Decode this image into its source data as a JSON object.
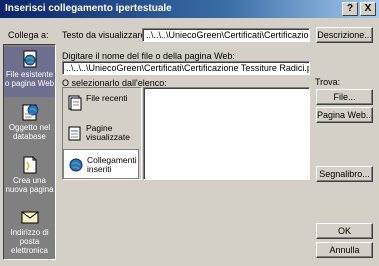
{
  "window": {
    "title": "Inserisci collegamento ipertestuale",
    "help_glyph": "?",
    "close_glyph": "X"
  },
  "link_to": {
    "label": "Collega a:"
  },
  "sidebar": {
    "items": [
      {
        "label": "File esistente o pagina Web",
        "icon": "web-page-icon"
      },
      {
        "label": "Oggetto nel database",
        "icon": "database-icon"
      },
      {
        "label": "Crea una nuova pagina",
        "icon": "new-page-icon"
      },
      {
        "label": "Indirizzo di posta elettronica",
        "icon": "email-icon"
      }
    ]
  },
  "display_text": {
    "label": "Testo da visualizzare:",
    "value": "..\\..\\..\\UniecoGreen\\Certificati\\Certificazione Te"
  },
  "screentip_button": "Descrizione...",
  "address": {
    "label": "Digitare il nome del file o della pagina Web:",
    "value": "..\\..\\..\\UniecoGreen\\Certificati\\Certificazione Tessiture Radici.pdf"
  },
  "list": {
    "label": "O selezionarlo dall'elenco:"
  },
  "browse": {
    "items": [
      {
        "label": "File recenti",
        "icon": "recent-files-icon"
      },
      {
        "label": "Pagine visualizzate",
        "icon": "browsed-pages-icon"
      },
      {
        "label": "Collegamenti inseriti",
        "icon": "inserted-links-icon"
      }
    ]
  },
  "find": {
    "label": "Trova:",
    "file_button": "File...",
    "web_button": "Pagina Web..."
  },
  "bookmark_button": "Segnalibro...",
  "ok_button": "OK",
  "cancel_button": "Annulla",
  "colors": {
    "title_bar": "#0a246a",
    "face": "#d4d0c8",
    "sidebar": "#808080"
  }
}
